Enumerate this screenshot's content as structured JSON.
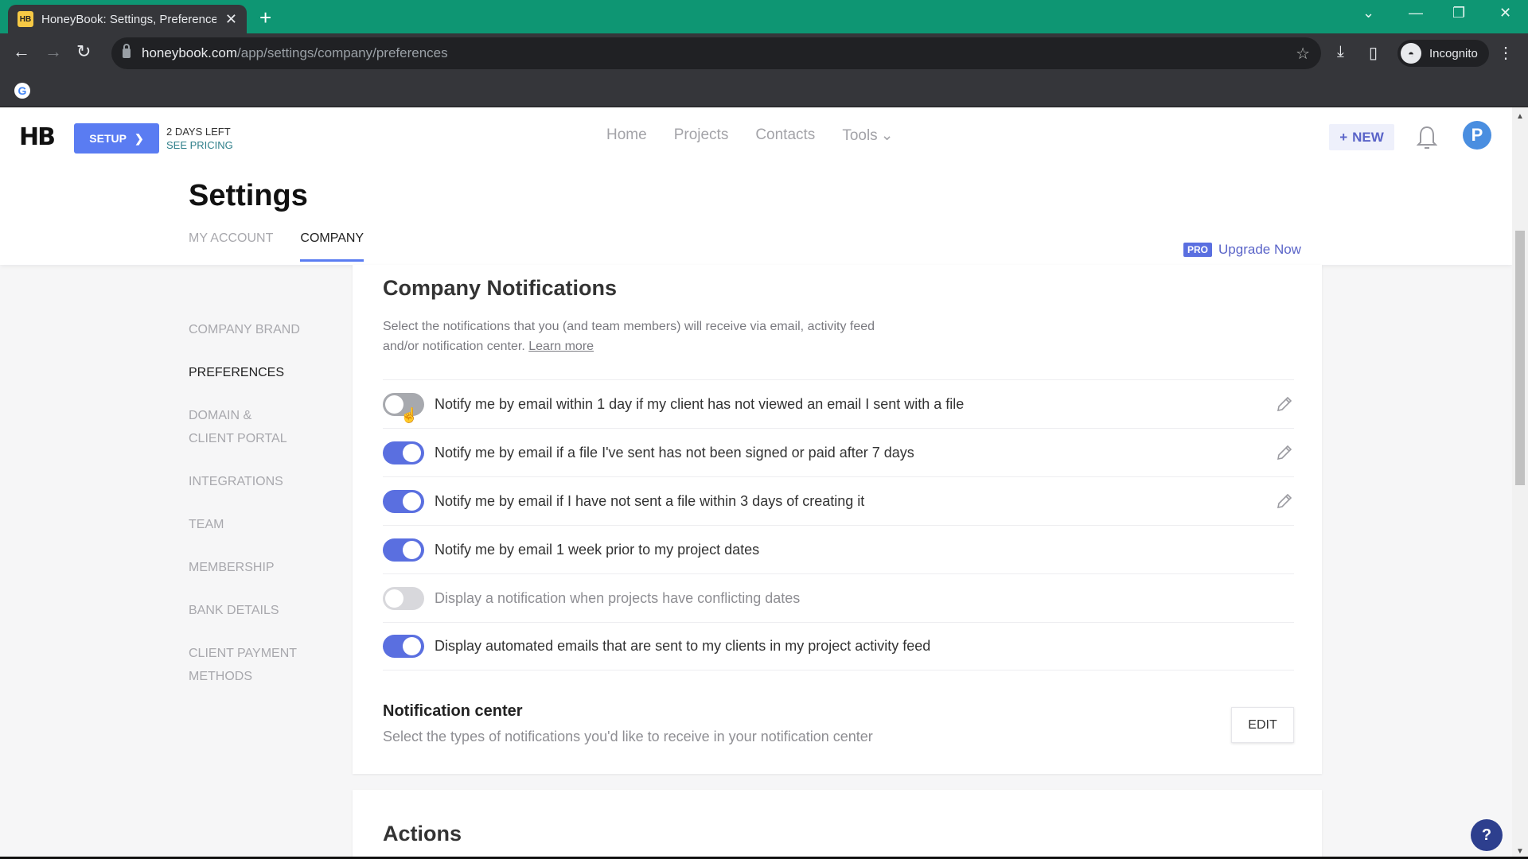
{
  "browser": {
    "tab_title": "HoneyBook: Settings, Preferences",
    "tab_favicon": "HB",
    "url_host": "honeybook.com",
    "url_path": "/app/settings/company/preferences",
    "profile_label": "Incognito"
  },
  "header": {
    "logo": "HB",
    "setup_label": "SETUP",
    "trial_days": "2 DAYS LEFT",
    "see_pricing": "SEE PRICING",
    "nav": [
      "Home",
      "Projects",
      "Contacts",
      "Tools"
    ],
    "new_label": "NEW",
    "avatar_initial": "P",
    "page_title": "Settings",
    "tabs": [
      {
        "label": "MY ACCOUNT",
        "active": false
      },
      {
        "label": "COMPANY",
        "active": true
      }
    ],
    "pro_badge": "PRO",
    "upgrade_label": "Upgrade Now"
  },
  "sidebar": {
    "items": [
      {
        "label": "COMPANY BRAND",
        "active": false
      },
      {
        "label": "PREFERENCES",
        "active": true
      },
      {
        "label": "DOMAIN & CLIENT PORTAL",
        "active": false
      },
      {
        "label": "INTEGRATIONS",
        "active": false
      },
      {
        "label": "TEAM",
        "active": false
      },
      {
        "label": "MEMBERSHIP",
        "active": false
      },
      {
        "label": "BANK DETAILS",
        "active": false
      },
      {
        "label": "CLIENT PAYMENT METHODS",
        "active": false
      }
    ]
  },
  "notifications": {
    "title": "Company Notifications",
    "description": "Select the notifications that you (and team members) will receive via email, activity feed and/or notification center.",
    "learn_more": "Learn more",
    "rows": [
      {
        "label": "Notify me by email within 1 day if my client has not viewed an email I sent with a file",
        "enabled": false,
        "editable": true
      },
      {
        "label": "Notify me by email if a file I've sent has not been signed or paid after 7 days",
        "enabled": true,
        "editable": true
      },
      {
        "label": "Notify me by email if I have not sent a file within 3 days of creating it",
        "enabled": true,
        "editable": true
      },
      {
        "label": "Notify me by email 1 week prior to my project dates",
        "enabled": true,
        "editable": false
      },
      {
        "label": "Display a notification when projects have conflicting dates",
        "enabled": false,
        "editable": false
      },
      {
        "label": "Display automated emails that are sent to my clients in my project activity feed",
        "enabled": true,
        "editable": false
      }
    ],
    "center_title": "Notification center",
    "center_desc": "Select the types of notifications you'd like to receive in your notification center",
    "edit_label": "EDIT"
  },
  "actions": {
    "title": "Actions"
  },
  "help_label": "?",
  "colors": {
    "accent": "#5a6fe0",
    "setup_button": "#5a7cf2",
    "chrome_tabstrip": "#0e9673",
    "help_button": "#2d3f8e"
  }
}
